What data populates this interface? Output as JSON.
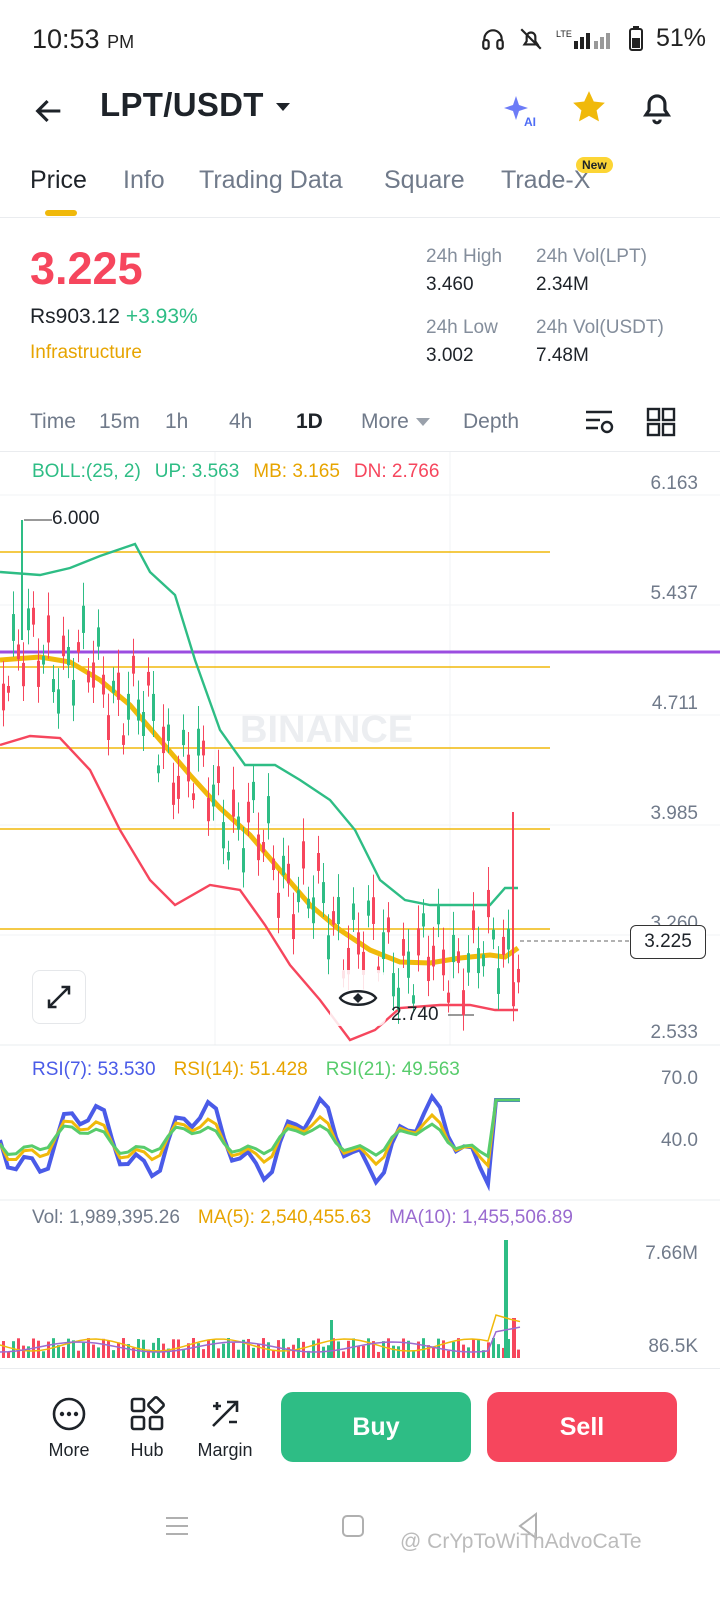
{
  "status_bar": {
    "time": "10:53",
    "ampm": "PM",
    "battery": "51%"
  },
  "header": {
    "pair": "LPT/USDT"
  },
  "tabs": [
    {
      "label": "Price",
      "active": true
    },
    {
      "label": "Info"
    },
    {
      "label": "Trading Data"
    },
    {
      "label": "Square"
    },
    {
      "label": "Trade-X",
      "badge": "New"
    }
  ],
  "ticker": {
    "last_price": "3.225",
    "fiat_price": "Rs903.12",
    "change": "+3.93%",
    "category": "Infrastructure",
    "high_label": "24h High",
    "high": "3.460",
    "low_label": "24h Low",
    "low": "3.002",
    "vol_base_label": "24h Vol(LPT)",
    "vol_base": "2.34M",
    "vol_quote_label": "24h Vol(USDT)",
    "vol_quote": "7.48M"
  },
  "timeframes": [
    "Time",
    "15m",
    "1h",
    "4h",
    "1D",
    "More",
    "Depth"
  ],
  "selected_timeframe": "1D",
  "boll": {
    "label": "BOLL:(25, 2)",
    "up": "UP: 3.563",
    "mb": "MB: 3.165",
    "dn": "DN: 2.766"
  },
  "price_axis": [
    "6.163",
    "5.437",
    "4.711",
    "3.985",
    "3.260",
    "2.533"
  ],
  "last_price_tag": "3.225",
  "annotations": {
    "high": "6.000",
    "low": "2.740"
  },
  "watermark": "BINANCE",
  "rsi": {
    "r7": "RSI(7): 53.530",
    "r14": "RSI(14): 51.428",
    "r21": "RSI(21): 49.563",
    "axis_top": "70.0",
    "axis_mid": "40.0"
  },
  "volume": {
    "vol": "Vol: 1,989,395.26",
    "ma5": "MA(5): 2,540,455.63",
    "ma10": "MA(10): 1,455,506.89",
    "axis_top": "7.66M",
    "axis_bottom": "86.5K"
  },
  "bottom_bar": {
    "more": "More",
    "hub": "Hub",
    "margin": "Margin",
    "buy": "Buy",
    "sell": "Sell"
  },
  "watermark_credit": "@ CrYpToWiThAdvoCaTe",
  "colors": {
    "up": "#2ebd85",
    "down": "#f6465d",
    "accent": "#f0b90b",
    "boll_up": "#2ebd85",
    "boll_mb": "#f0b90b",
    "boll_dn": "#f6465d",
    "rsi7": "#4a5be8",
    "rsi14": "#f0b90b",
    "rsi21": "#58cc6c",
    "ma10": "#9a6bd0",
    "hline": "#9b4de0"
  }
}
